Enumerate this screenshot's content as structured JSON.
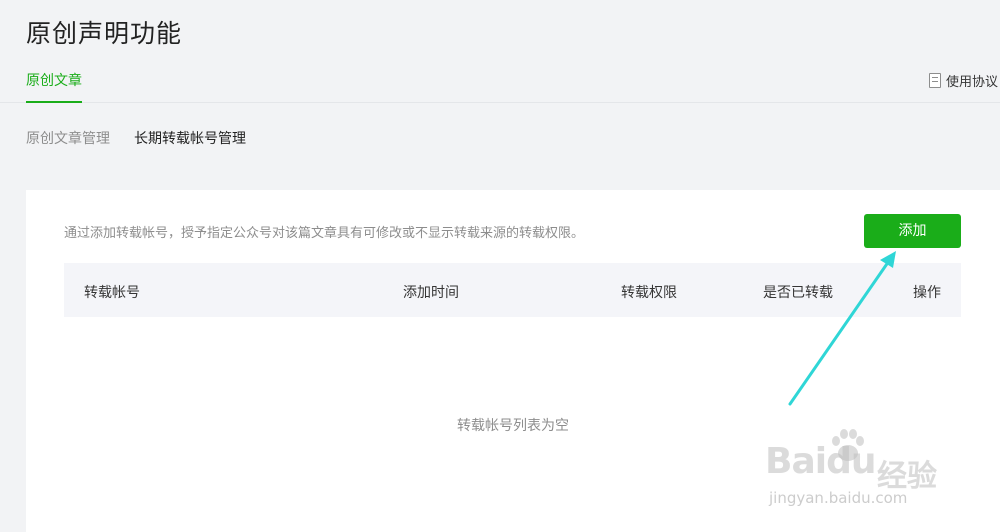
{
  "page": {
    "title": "原创声明功能"
  },
  "tabs": {
    "original_articles": "原创文章",
    "agreement": "使用协议"
  },
  "sub_tabs": {
    "manage_original": "原创文章管理",
    "manage_repost_accounts": "长期转载帐号管理"
  },
  "panel": {
    "description": "通过添加转载帐号，授予指定公众号对该篇文章具有可修改或不显示转载来源的转载权限。",
    "add_button": "添加",
    "table": {
      "headers": [
        "转载帐号",
        "添加时间",
        "转载权限",
        "是否已转载",
        "操作"
      ]
    },
    "empty_text": "转载帐号列表为空"
  },
  "annotation": {
    "arrow_color": "#2fd6d6"
  },
  "watermark": {
    "brand": "Baidu",
    "brand_cn": "经验",
    "url": "jingyan.baidu.com"
  },
  "colors": {
    "accent": "#1aad19",
    "background": "#f2f3f5",
    "header_bg": "#f4f5f9"
  }
}
